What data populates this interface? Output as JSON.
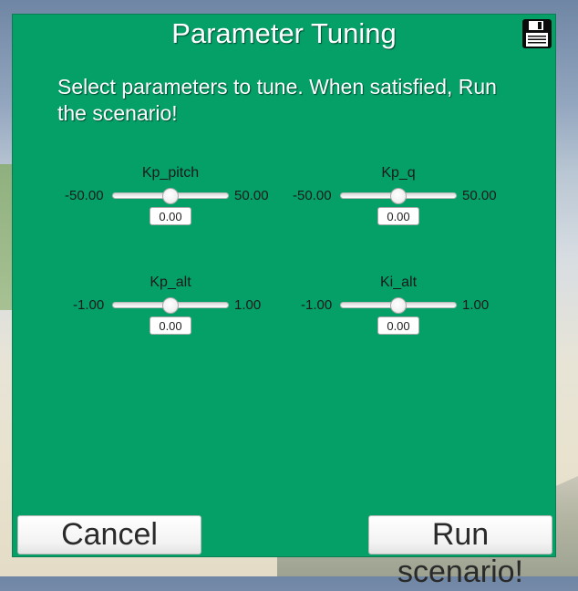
{
  "panel": {
    "title": "Parameter Tuning",
    "instructions": "Select parameters to tune. When satisfied, Run the scenario!",
    "background_color": "#04a068"
  },
  "icons": {
    "save": "floppy-disk-icon"
  },
  "params": [
    {
      "name": "Kp_pitch",
      "min": "-50.00",
      "max": "50.00",
      "value": "0.00",
      "level": 0.5
    },
    {
      "name": "Kp_q",
      "min": "-50.00",
      "max": "50.00",
      "value": "0.00",
      "level": 0.5
    },
    {
      "name": "Kp_alt",
      "min": "-1.00",
      "max": "1.00",
      "value": "0.00",
      "level": 0.5
    },
    {
      "name": "Ki_alt",
      "min": "-1.00",
      "max": "1.00",
      "value": "0.00",
      "level": 0.5
    }
  ],
  "buttons": {
    "cancel": "Cancel",
    "run": "Run scenario!"
  }
}
